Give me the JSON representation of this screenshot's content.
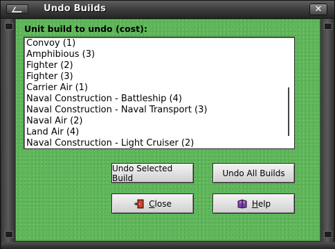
{
  "window": {
    "title": "Undo Builds"
  },
  "prompt": "Unit build to undo (cost):",
  "units": [
    "Convoy (1)",
    "Amphibious (3)",
    "Fighter (2)",
    "Fighter (3)",
    "Carrier Air (1)",
    "Naval Construction - Battleship (4)",
    "Naval Construction - Naval Transport (3)",
    "Naval Air (2)",
    "Land Air (4)",
    "Naval Construction - Light Cruiser (2)"
  ],
  "buttons": {
    "undo_selected": "Undo Selected Build",
    "undo_all": "Undo All Builds",
    "close_access": "C",
    "close_rest": "lose",
    "help_access": "H",
    "help_rest": "elp"
  },
  "icons": {
    "title": "window-menu-icon",
    "close_button": "close-door-icon",
    "help_button": "help-book-icon"
  },
  "colors": {
    "background": "#5fb85a"
  }
}
